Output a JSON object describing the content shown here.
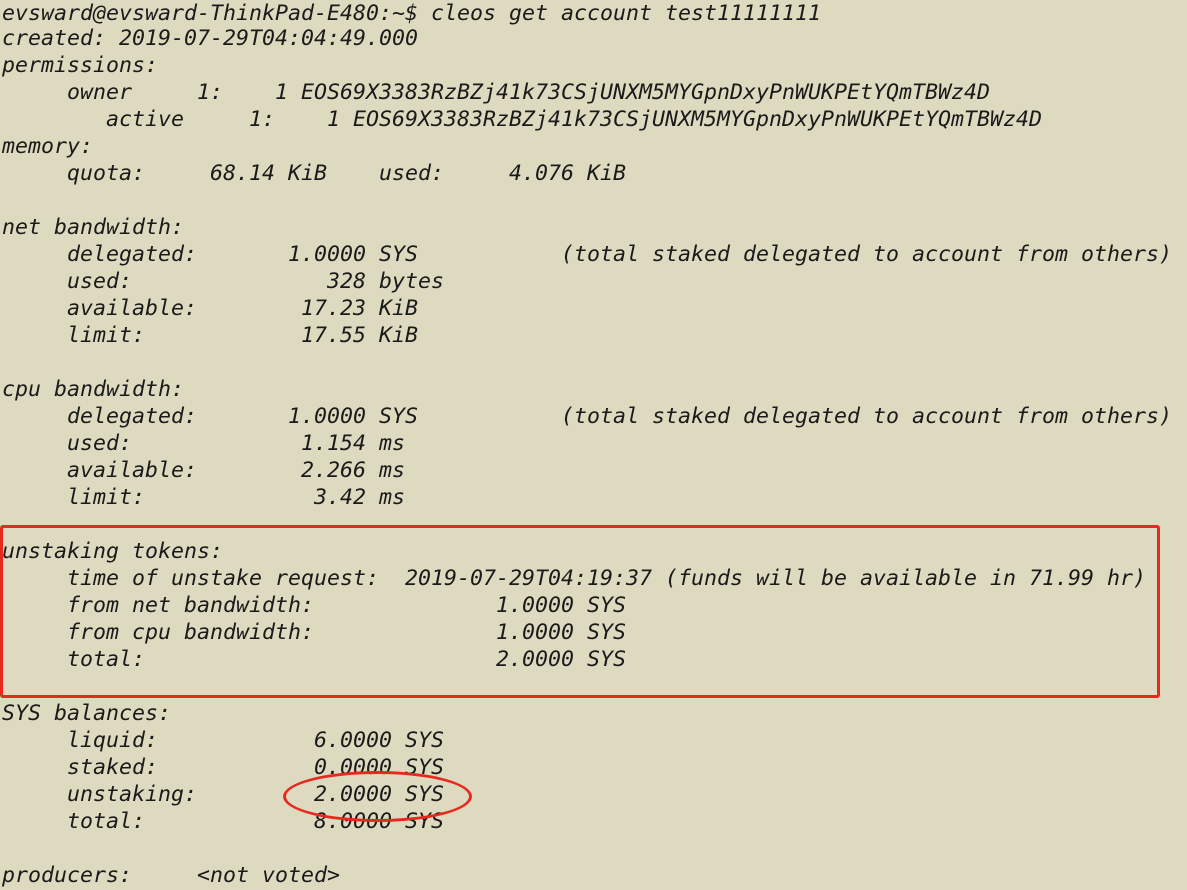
{
  "terminal": {
    "lines": [
      "evsward@evsward-ThinkPad-E480:~$ cleos get account test11111111",
      "created: 2019-07-29T04:04:49.000",
      "permissions:",
      "     owner     1:    1 EOS69X3383RzBZj41k73CSjUNXM5MYGpnDxyPnWUKPEtYQmTBWz4D",
      "        active     1:    1 EOS69X3383RzBZj41k73CSjUNXM5MYGpnDxyPnWUKPEtYQmTBWz4D",
      "memory:",
      "     quota:     68.14 KiB    used:     4.076 KiB",
      "",
      "net bandwidth:",
      "     delegated:       1.0000 SYS           (total staked delegated to account from others)",
      "     used:               328 bytes",
      "     available:        17.23 KiB",
      "     limit:            17.55 KiB",
      "",
      "cpu bandwidth:",
      "     delegated:       1.0000 SYS           (total staked delegated to account from others)",
      "     used:             1.154 ms",
      "     available:        2.266 ms",
      "     limit:             3.42 ms",
      "",
      "unstaking tokens:",
      "     time of unstake request:  2019-07-29T04:19:37 (funds will be available in 71.99 hr)",
      "     from net bandwidth:              1.0000 SYS",
      "     from cpu bandwidth:              1.0000 SYS",
      "     total:                           2.0000 SYS",
      "",
      "SYS balances:",
      "     liquid:            6.0000 SYS",
      "     staked:            0.0000 SYS",
      "     unstaking:         2.0000 SYS",
      "     total:             8.0000 SYS",
      "",
      "producers:     <not voted>"
    ]
  },
  "colors": {
    "background": "#dedac0",
    "text": "#1a1a1a",
    "highlight": "#e8281e"
  }
}
